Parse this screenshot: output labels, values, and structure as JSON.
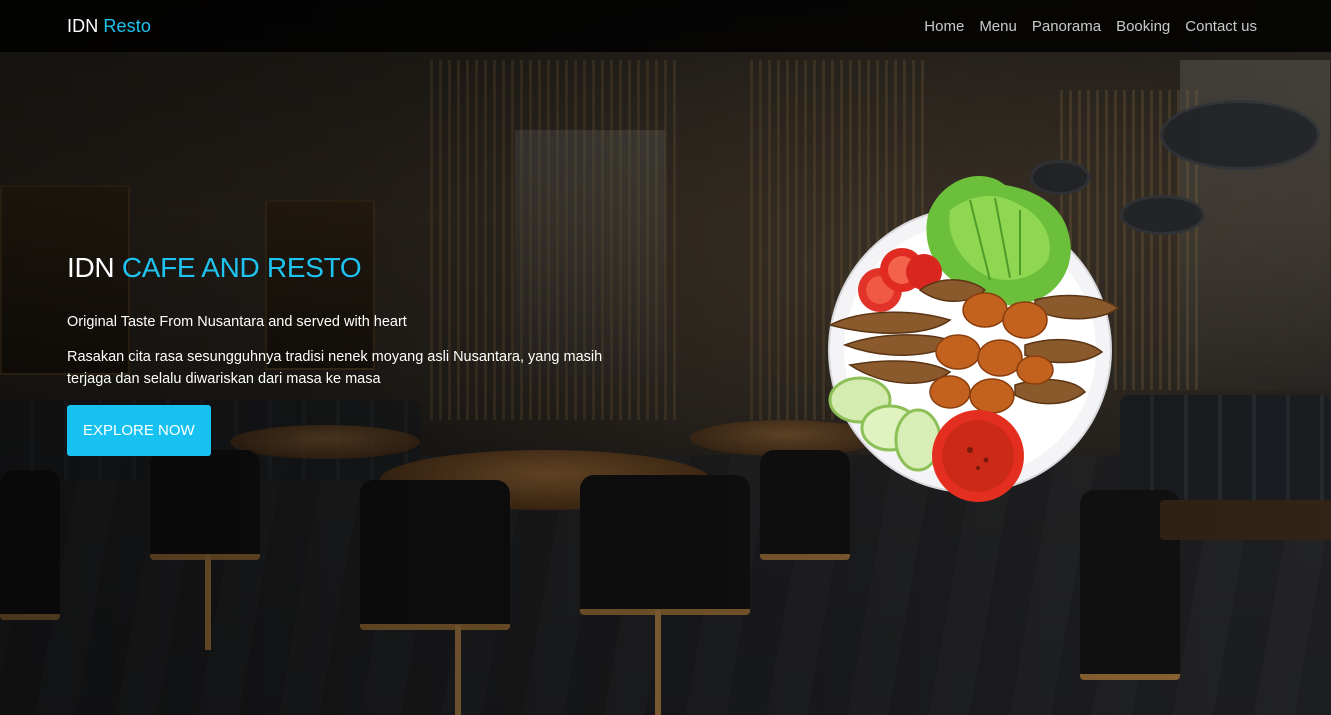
{
  "brand": {
    "name": "IDN",
    "accent": "Resto"
  },
  "nav": {
    "items": [
      {
        "label": "Home"
      },
      {
        "label": "Menu"
      },
      {
        "label": "Panorama"
      },
      {
        "label": "Booking"
      },
      {
        "label": "Contact us"
      }
    ]
  },
  "hero": {
    "title_prefix": "IDN",
    "title_accent": "CAFE AND RESTO",
    "tagline": "Original Taste From Nusantara and served with heart",
    "description": "Rasakan cita rasa sesungguhnya tradisi nenek moyang asli Nusantara, yang masih terjaga dan selalu diwariskan dari masa ke masa",
    "cta_label": "EXPLORE NOW"
  },
  "colors": {
    "accent": "#1ec3ef",
    "button": "#17c2f0",
    "navbar": "#000000"
  },
  "icons": {
    "food_plate": "fried-fish-plate-image",
    "background": "restaurant-interior-photo"
  }
}
